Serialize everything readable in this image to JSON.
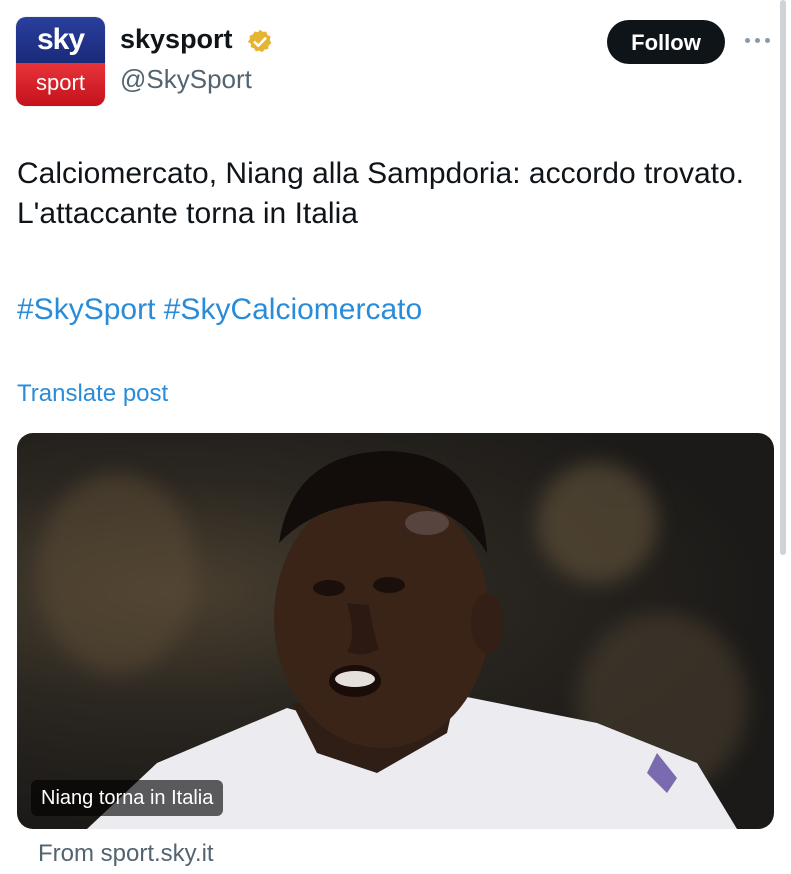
{
  "account": {
    "logo_top": "sky",
    "logo_bottom": "sport",
    "display_name": "skysport",
    "handle": "@SkySport",
    "verified": true,
    "verified_icon": "gold-verified-badge-icon"
  },
  "actions": {
    "follow_label": "Follow",
    "more_icon": "more-horizontal-icon"
  },
  "post": {
    "text": "Calciomercato, Niang alla Sampdoria: accordo trovato. L'attaccante torna in Italia",
    "hashtags": [
      "#SkySport",
      "#SkyCalciomercato"
    ],
    "translate_label": "Translate post"
  },
  "media": {
    "caption": "Niang torna in Italia",
    "source": "From sport.sky.it"
  },
  "colors": {
    "link": "#2a8cd8",
    "follow_bg": "#0f1419",
    "sky_blue": "#2a3f9d",
    "sky_red": "#e8333a",
    "verified_gold": "#e5b431"
  }
}
